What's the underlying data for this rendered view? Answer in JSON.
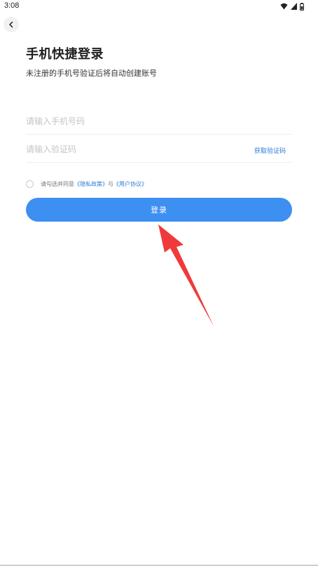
{
  "status_bar": {
    "time": "3:08",
    "icons": [
      "wifi-icon",
      "signal-icon",
      "battery-icon"
    ]
  },
  "nav": {
    "back_icon": "chevron-left-icon"
  },
  "login": {
    "title": "手机快捷登录",
    "subtitle": "未注册的手机号验证后将自动创建账号",
    "phone_placeholder": "请输入手机号码",
    "phone_value": "",
    "code_placeholder": "请输入验证码",
    "code_value": "",
    "get_code_label": "获取验证码",
    "agree_prefix": "请勾选并同意",
    "privacy_link": "《隐私政策》",
    "agree_and": "与",
    "terms_link": "《用户协议》",
    "agree_checked": false,
    "login_button": "登录"
  },
  "colors": {
    "accent": "#3d8ff2",
    "link": "#2e7bd6",
    "annotation_arrow": "#f0393b"
  }
}
